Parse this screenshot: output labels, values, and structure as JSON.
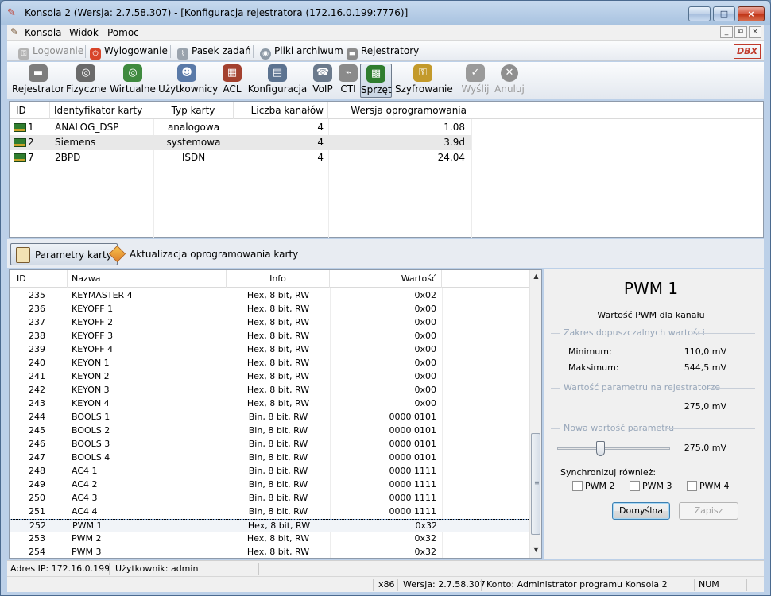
{
  "window": {
    "title": "Konsola 2 (Wersja:  2.7.58.307) - [Konfiguracja rejestratora (172.16.0.199:7776)]",
    "minimize": "−",
    "maximize": "□",
    "close": "×"
  },
  "menu": {
    "items": [
      "Konsola",
      "Widok",
      "Pomoc"
    ],
    "mdi": [
      "_",
      "⧉",
      "×"
    ]
  },
  "toolbar_top": {
    "logowanie": "Logowanie",
    "wylogowanie": "Wylogowanie",
    "pasek_zadan": "Pasek zadań",
    "pliki_archiwum": "Pliki archiwum",
    "rejestratory": "Rejestratory",
    "logo": "DBX"
  },
  "toolbar_main": {
    "buttons": [
      {
        "label": "Rejestrator",
        "icon": "recorder-icon",
        "color": "#7d7d7d"
      },
      {
        "label": "Fizyczne",
        "icon": "physical-channels-icon",
        "color": "#6a6a6a"
      },
      {
        "label": "Wirtualne",
        "icon": "virtual-channels-icon",
        "color": "#3f8a3f"
      },
      {
        "label": "Użytkownicy",
        "icon": "users-icon",
        "color": "#5a7aa8"
      },
      {
        "label": "ACL",
        "icon": "acl-icon",
        "color": "#a3412f"
      },
      {
        "label": "Konfiguracja",
        "icon": "configuration-icon",
        "color": "#5c7390"
      },
      {
        "label": "VoIP",
        "icon": "voip-icon",
        "color": "#6b7a8c"
      },
      {
        "label": "CTI",
        "icon": "cti-icon",
        "color": "#8a8a8a"
      },
      {
        "label": "Sprzęt",
        "icon": "hardware-icon",
        "color": "#2f7d2f"
      },
      {
        "label": "Szyfrowanie",
        "icon": "encryption-key-icon",
        "color": "#c39a2b"
      },
      {
        "label": "Wyślij",
        "icon": "send-check-icon",
        "color": "#9a9a9a"
      },
      {
        "label": "Anuluj",
        "icon": "cancel-icon",
        "color": "#8f8f8f"
      }
    ]
  },
  "cards_table": {
    "headers": [
      "ID",
      "Identyfikator karty",
      "Typ karty",
      "Liczba kanałów",
      "Wersja oprogramowania"
    ],
    "rows": [
      {
        "id": "1",
        "name": "ANALOG_DSP",
        "type": "analogowa",
        "channels": "4",
        "version": "1.08"
      },
      {
        "id": "2",
        "name": "Siemens",
        "type": "systemowa",
        "channels": "4",
        "version": "3.9d"
      },
      {
        "id": "7",
        "name": "2BPD",
        "type": "ISDN",
        "channels": "4",
        "version": "24.04"
      }
    ]
  },
  "tabs": {
    "params": "Parametry karty",
    "firmware": "Aktualizacja oprogramowania karty"
  },
  "params_table": {
    "headers": [
      "ID",
      "Nazwa",
      "Info",
      "Wartość"
    ],
    "rows": [
      {
        "id": "235",
        "name": "KEYMASTER 4",
        "info": "Hex, 8 bit, RW",
        "value": "0x02"
      },
      {
        "id": "236",
        "name": "KEYOFF 1",
        "info": "Hex, 8 bit, RW",
        "value": "0x00"
      },
      {
        "id": "237",
        "name": "KEYOFF 2",
        "info": "Hex, 8 bit, RW",
        "value": "0x00"
      },
      {
        "id": "238",
        "name": "KEYOFF 3",
        "info": "Hex, 8 bit, RW",
        "value": "0x00"
      },
      {
        "id": "239",
        "name": "KEYOFF 4",
        "info": "Hex, 8 bit, RW",
        "value": "0x00"
      },
      {
        "id": "240",
        "name": "KEYON 1",
        "info": "Hex, 8 bit, RW",
        "value": "0x00"
      },
      {
        "id": "241",
        "name": "KEYON 2",
        "info": "Hex, 8 bit, RW",
        "value": "0x00"
      },
      {
        "id": "242",
        "name": "KEYON 3",
        "info": "Hex, 8 bit, RW",
        "value": "0x00"
      },
      {
        "id": "243",
        "name": "KEYON 4",
        "info": "Hex, 8 bit, RW",
        "value": "0x00"
      },
      {
        "id": "244",
        "name": "BOOLS 1",
        "info": "Bin, 8 bit, RW",
        "value": "0000 0101"
      },
      {
        "id": "245",
        "name": "BOOLS 2",
        "info": "Bin, 8 bit, RW",
        "value": "0000 0101"
      },
      {
        "id": "246",
        "name": "BOOLS 3",
        "info": "Bin, 8 bit, RW",
        "value": "0000 0101"
      },
      {
        "id": "247",
        "name": "BOOLS 4",
        "info": "Bin, 8 bit, RW",
        "value": "0000 0101"
      },
      {
        "id": "248",
        "name": "AC4 1",
        "info": "Bin, 8 bit, RW",
        "value": "0000 1111"
      },
      {
        "id": "249",
        "name": "AC4 2",
        "info": "Bin, 8 bit, RW",
        "value": "0000 1111"
      },
      {
        "id": "250",
        "name": "AC4 3",
        "info": "Bin, 8 bit, RW",
        "value": "0000 1111"
      },
      {
        "id": "251",
        "name": "AC4 4",
        "info": "Bin, 8 bit, RW",
        "value": "0000 1111"
      },
      {
        "id": "252",
        "name": "PWM 1",
        "info": "Hex, 8 bit, RW",
        "value": "0x32"
      },
      {
        "id": "253",
        "name": "PWM 2",
        "info": "Hex, 8 bit, RW",
        "value": "0x32"
      },
      {
        "id": "254",
        "name": "PWM 3",
        "info": "Hex, 8 bit, RW",
        "value": "0x32"
      }
    ],
    "selected_id": "252"
  },
  "detail": {
    "title": "PWM 1",
    "subtitle": "Wartość PWM dla kanału",
    "range_group": "Zakres dopuszczalnych wartości",
    "min_label": "Minimum:",
    "min_value": "110,0 mV",
    "max_label": "Maksimum:",
    "max_value": "544,5 mV",
    "current_group": "Wartość parametru na rejestratorze",
    "current_value": "275,0 mV",
    "new_group": "Nowa wartość parametru",
    "new_value": "275,0 mV",
    "slider_fraction": 0.38,
    "sync_label": "Synchronizuj również:",
    "sync_options": [
      "PWM 2",
      "PWM 3",
      "PWM 4"
    ],
    "default_button": "Domyślna",
    "save_button": "Zapisz"
  },
  "status": {
    "ip": "Adres IP: 172.16.0.199",
    "user": "Użytkownik: admin",
    "arch": "x86",
    "version": "Wersja: 2.7.58.307",
    "account": "Konto: Administrator programu Konsola 2",
    "num": "NUM"
  }
}
